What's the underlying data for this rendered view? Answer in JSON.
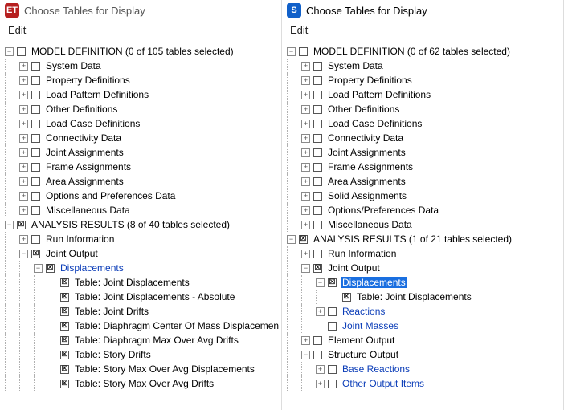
{
  "panels": {
    "left": {
      "app_code": "ET",
      "title": "Choose Tables for Display",
      "menu_edit": "Edit",
      "model_def_header": "MODEL DEFINITION  (0 of 105 tables selected)",
      "model_def_items": [
        "System Data",
        "Property Definitions",
        "Load Pattern Definitions",
        "Other Definitions",
        "Load Case Definitions",
        "Connectivity Data",
        "Joint Assignments",
        "Frame Assignments",
        "Area Assignments",
        "Options and Preferences Data",
        "Miscellaneous Data"
      ],
      "analysis_header": "ANALYSIS RESULTS  (8 of 40 tables selected)",
      "run_info": "Run Information",
      "joint_output": "Joint Output",
      "displacements": "Displacements",
      "tables": [
        "Table:  Joint Displacements",
        "Table:  Joint Displacements - Absolute",
        "Table:  Joint Drifts",
        "Table:  Diaphragm Center Of Mass Displacemen",
        "Table:  Diaphragm Max Over Avg Drifts",
        "Table:  Story Drifts",
        "Table:  Story Max Over Avg Displacements",
        "Table:  Story Max Over Avg Drifts"
      ]
    },
    "right": {
      "app_code": "S",
      "title": "Choose Tables for Display",
      "menu_edit": "Edit",
      "model_def_header": "MODEL DEFINITION  (0 of 62 tables selected)",
      "model_def_items": [
        "System Data",
        "Property Definitions",
        "Load Pattern Definitions",
        "Other Definitions",
        "Load Case Definitions",
        "Connectivity Data",
        "Joint Assignments",
        "Frame Assignments",
        "Area Assignments",
        "Solid Assignments",
        "Options/Preferences Data",
        "Miscellaneous Data"
      ],
      "analysis_header": "ANALYSIS RESULTS  (1 of 21 tables selected)",
      "run_info": "Run Information",
      "joint_output": "Joint Output",
      "displacements": "Displacements",
      "joint_disp_table": "Table:  Joint Displacements",
      "reactions": "Reactions",
      "joint_masses": "Joint Masses",
      "element_output": "Element Output",
      "structure_output": "Structure Output",
      "base_reactions": "Base Reactions",
      "other_output": "Other Output Items"
    }
  },
  "glyphs": {
    "plus": "+",
    "minus": "−",
    "check": "⊠"
  }
}
